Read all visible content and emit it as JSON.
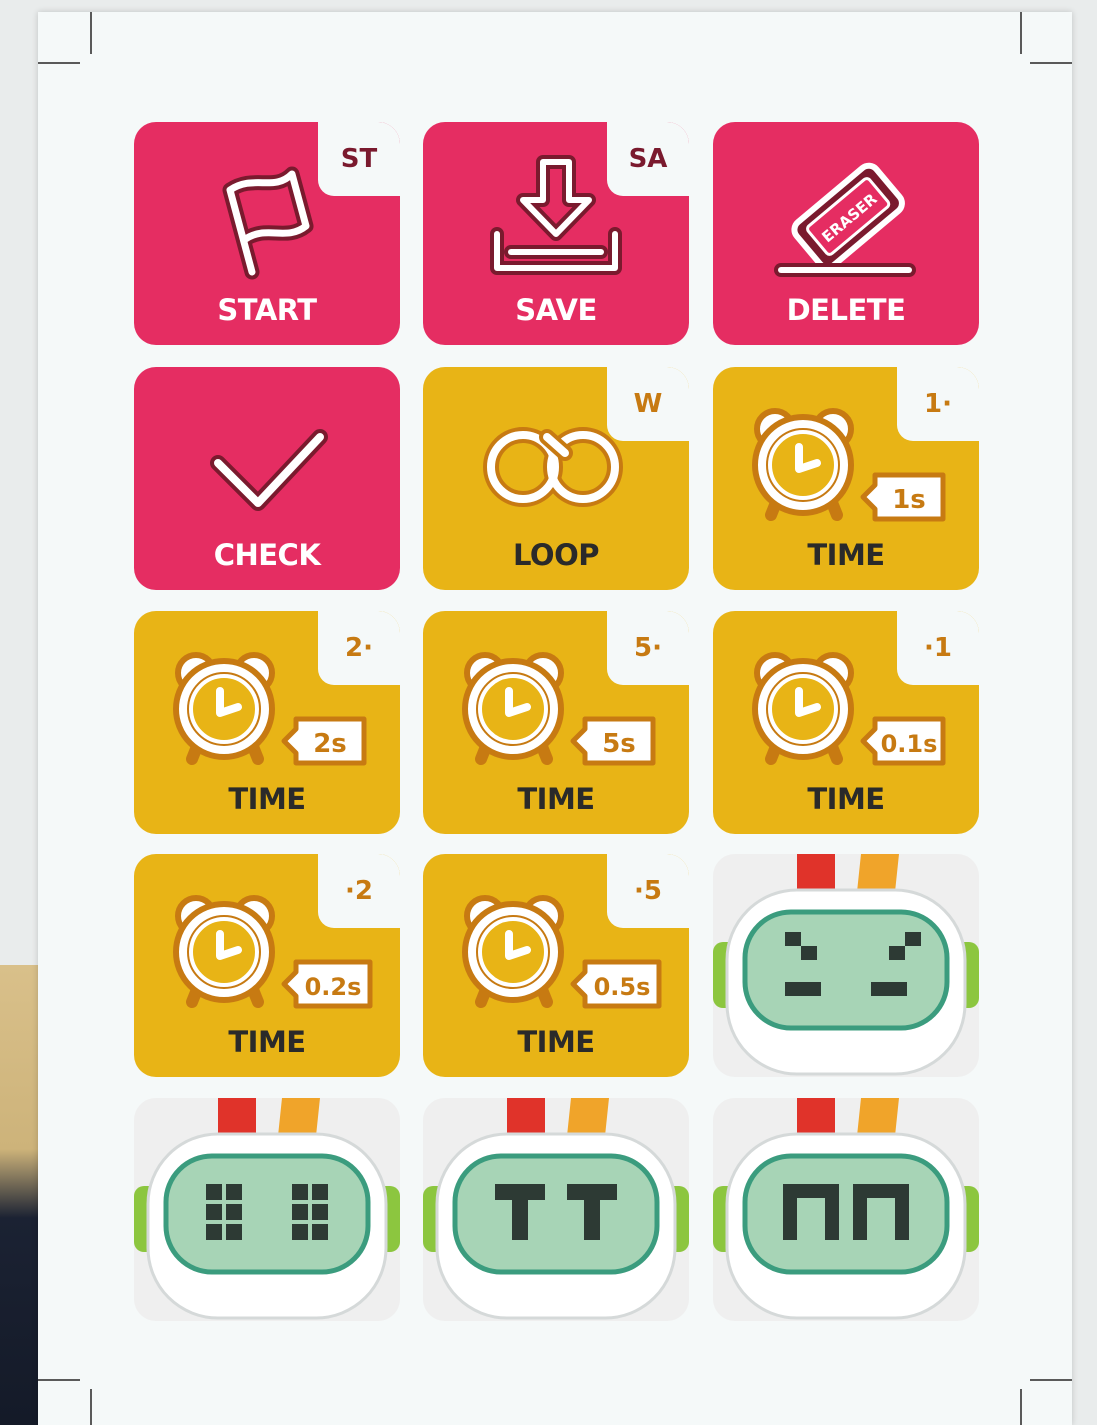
{
  "cards": [
    {
      "label": "START",
      "tag": "ST",
      "color": "#e52d62",
      "icon": "flag-icon"
    },
    {
      "label": "SAVE",
      "tag": "SA",
      "color": "#e52d62",
      "icon": "download-tray-icon"
    },
    {
      "label": "DELETE",
      "tag": "",
      "color": "#e52d62",
      "icon": "eraser-icon",
      "icon_text": "ERASER"
    },
    {
      "label": "CHECK",
      "tag": "",
      "color": "#e52d62",
      "icon": "checkmark-icon"
    },
    {
      "label": "LOOP",
      "tag": "W",
      "color": "#e8b416",
      "icon": "infinity-loop-icon"
    },
    {
      "label": "TIME",
      "tag": "1·",
      "color": "#e8b416",
      "icon": "alarm-clock-icon",
      "bubble": "1s"
    },
    {
      "label": "TIME",
      "tag": "2·",
      "color": "#e8b416",
      "icon": "alarm-clock-icon",
      "bubble": "2s"
    },
    {
      "label": "TIME",
      "tag": "5·",
      "color": "#e8b416",
      "icon": "alarm-clock-icon",
      "bubble": "5s"
    },
    {
      "label": "TIME",
      "tag": "·1",
      "color": "#e8b416",
      "icon": "alarm-clock-icon",
      "bubble": "0.1s"
    },
    {
      "label": "TIME",
      "tag": "·2",
      "color": "#e8b416",
      "icon": "alarm-clock-icon",
      "bubble": "0.2s"
    },
    {
      "label": "TIME",
      "tag": "·5",
      "color": "#e8b416",
      "icon": "alarm-clock-icon",
      "bubble": "0.5s"
    }
  ],
  "robots": [
    {
      "face": "angry-face-icon"
    },
    {
      "face": "square-eyes-face-icon"
    },
    {
      "face": "t-eyes-face-icon"
    },
    {
      "face": "m-eyes-face-icon"
    }
  ],
  "colors": {
    "card_red": "#e52d62",
    "card_yellow": "#e8b416",
    "sheet": "#f5f9f9",
    "robot_screen": "#a7d4b6",
    "robot_antenna_red": "#e0332a",
    "robot_antenna_orange": "#f0a42a",
    "robot_ear": "#8cc63f"
  }
}
